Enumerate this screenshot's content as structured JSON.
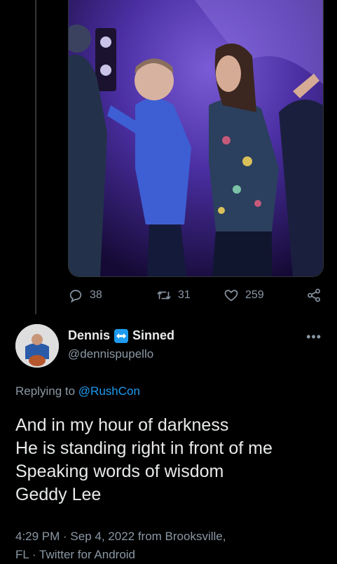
{
  "actions": {
    "replies": "38",
    "retweets": "31",
    "likes": "259"
  },
  "reply": {
    "display_name_part1": "Dennis",
    "display_name_part2": "Sinned",
    "handle": "@dennispupello",
    "more_label": "•••",
    "replying_prefix": "Replying to",
    "replying_to": "@RushCon",
    "text_lines": [
      "And in my hour of darkness",
      "He is standing right in front of me",
      "Speaking words of wisdom",
      "Geddy Lee"
    ],
    "meta_line1": "4:29 PM · Sep 4, 2022 from Brooksville,",
    "meta_line2": "FL · Twitter for Android"
  },
  "colors": {
    "accent": "#1d9bf0",
    "muted": "#8b98a5",
    "background": "#000000"
  }
}
